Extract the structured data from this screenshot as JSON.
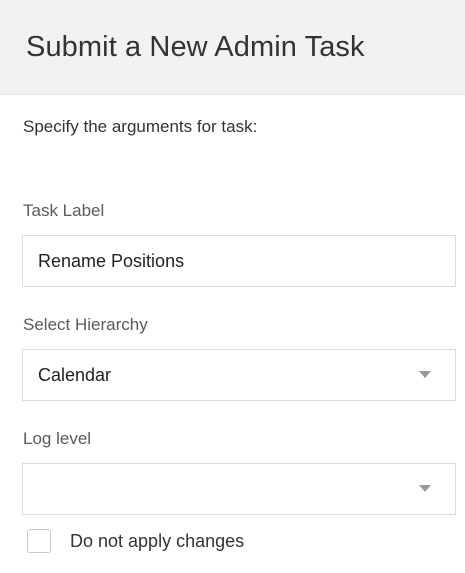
{
  "dialog": {
    "title": "Submit a New Admin Task",
    "instructions": "Specify the arguments for task:"
  },
  "fields": {
    "task_label": {
      "label": "Task Label",
      "value": "Rename Positions"
    },
    "hierarchy": {
      "label": "Select Hierarchy",
      "selected": "Calendar",
      "icon": "chevron-down-icon"
    },
    "log_level": {
      "label": "Log level",
      "selected": "",
      "icon": "chevron-down-icon"
    }
  },
  "options": {
    "do_not_apply": {
      "label": "Do not apply changes",
      "checked": false
    }
  }
}
